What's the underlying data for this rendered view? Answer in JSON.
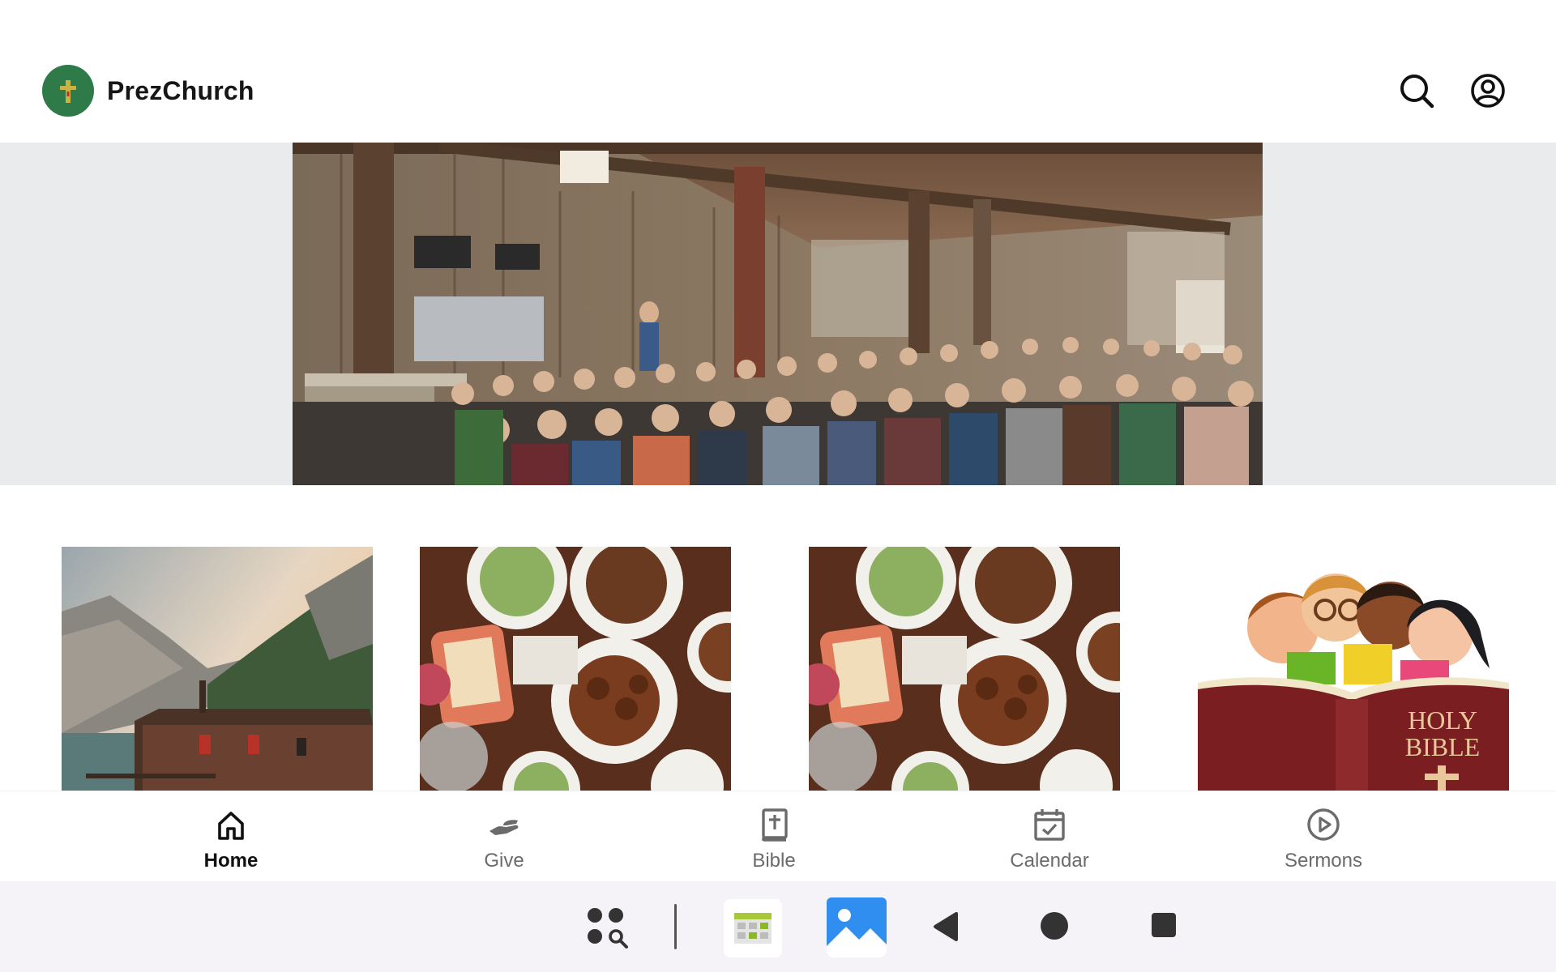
{
  "header": {
    "app_title": "PrezChurch",
    "logo_icon": "cross-logo-icon",
    "search_icon": "search-icon",
    "account_icon": "account-circle-icon"
  },
  "hero": {
    "image": "barn-church-congregation-photo"
  },
  "cards": [
    {
      "image": "mountain-lake-cabin-photo"
    },
    {
      "image": "dinner-table-food-photo"
    },
    {
      "image": "dinner-table-food-photo"
    },
    {
      "image": "kids-holy-bible-illustration",
      "image_text": "HOLY BIBLE"
    }
  ],
  "bottom_nav": {
    "items": [
      {
        "label": "Home",
        "icon": "home-icon",
        "active": true
      },
      {
        "label": "Give",
        "icon": "giving-hand-icon",
        "active": false
      },
      {
        "label": "Bible",
        "icon": "bible-icon",
        "active": false
      },
      {
        "label": "Calendar",
        "icon": "calendar-check-icon",
        "active": false
      },
      {
        "label": "Sermons",
        "icon": "play-circle-icon",
        "active": false
      }
    ]
  },
  "system_bar": {
    "items": [
      "app-drawer-search-icon",
      "divider",
      "calendar-app-icon",
      "gallery-app-icon",
      "back-icon",
      "home-circle-icon",
      "recents-square-icon"
    ]
  },
  "colors": {
    "logo_green": "#2e7a48",
    "hero_band": "#eaebed",
    "nav_active": "#111111",
    "nav_inactive": "#6b6b6b",
    "system_bar": "#f5f3f8",
    "bible_maroon": "#7a1e22"
  }
}
